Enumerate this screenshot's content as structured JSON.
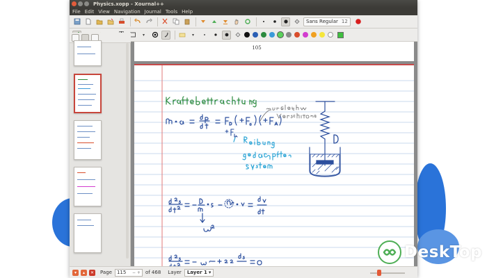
{
  "window": {
    "title": "Physics.xopp - Xournal++"
  },
  "menubar": {
    "items": [
      "File",
      "Edit",
      "View",
      "Navigation",
      "Journal",
      "Tools",
      "Help"
    ]
  },
  "toolbar": {
    "font_name": "Sans Regular",
    "font_size": "12",
    "colors": [
      "#111111",
      "#2b5fb4",
      "#2b8a3e",
      "#3b9ad9",
      "#5bd15b",
      "#8a8a8a",
      "#d94d2b",
      "#d23ccf",
      "#f0a020",
      "#f5e63a",
      "#ffffff"
    ],
    "selected_color": "#3fbf3f"
  },
  "document": {
    "page_number": "105"
  },
  "statusbar": {
    "page_label": "Page",
    "page_value": "115",
    "of_label": "of 468",
    "layer_label": "Layer",
    "layer_value": "Layer 1"
  },
  "watermark": {
    "text": "DeskTop"
  }
}
